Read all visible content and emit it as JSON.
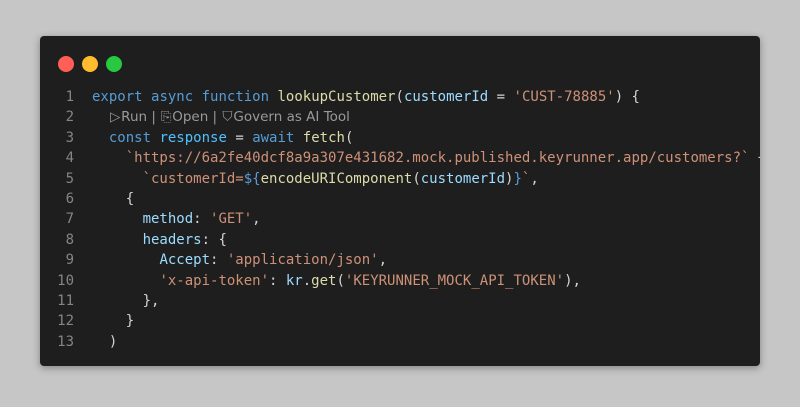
{
  "window": {
    "traffic_lights": [
      {
        "name": "close-button",
        "color": "#ff5f57"
      },
      {
        "name": "minimize-button",
        "color": "#febc2e"
      },
      {
        "name": "maximize-button",
        "color": "#28c840"
      }
    ]
  },
  "colors": {
    "background": "#1e1e1e",
    "keyword": "#569cd6",
    "function": "#dcdcaa",
    "variable": "#9cdcfe",
    "string": "#ce9178",
    "constant": "#4fc1ff",
    "line_number": "#858585",
    "codelens": "#999999"
  },
  "codelens": {
    "run": "Run",
    "open": "Open",
    "govern": "Govern as AI Tool",
    "separator": " | "
  },
  "code": {
    "line_numbers": [
      "1",
      "2",
      "3",
      "4",
      "5",
      "6",
      "7",
      "8",
      "9",
      "10",
      "11",
      "12",
      "13"
    ],
    "l1": {
      "export": "export",
      "async": "async",
      "function": "function",
      "name": "lookupCustomer",
      "open_paren": "(",
      "param": "customerId",
      "eq": " = ",
      "default": "'CUST-78885'",
      "close": ") {"
    },
    "l3": {
      "const": "const",
      "var": "response",
      "eq": " = ",
      "await": "await",
      "fetch": "fetch",
      "open": "("
    },
    "l4": {
      "str": "`https://6a2fe40dcf8a9a307e431682.mock.published.keyrunner.app/customers?`",
      "plus": " +"
    },
    "l5": {
      "str1": "`customerId=",
      "interp_open": "${",
      "fn": "encodeURIComponent",
      "paren_open": "(",
      "arg": "customerId",
      "paren_close": ")",
      "interp_close": "}",
      "str2": "`",
      "comma": ","
    },
    "l6": {
      "text": "{"
    },
    "l7": {
      "key": "method",
      "colon": ": ",
      "val": "'GET'",
      "comma": ","
    },
    "l8": {
      "key": "headers",
      "rest": ": {"
    },
    "l9": {
      "key": "Accept",
      "colon": ": ",
      "val": "'application/json'",
      "comma": ","
    },
    "l10": {
      "key": "'x-api-token'",
      "colon": ": ",
      "obj": "kr",
      "dot": ".",
      "fn": "get",
      "open": "(",
      "arg": "'KEYRUNNER_MOCK_API_TOKEN'",
      "close": "),"
    },
    "l11": {
      "text": "},"
    },
    "l12": {
      "text": "}"
    },
    "l13": {
      "text": ")"
    }
  }
}
